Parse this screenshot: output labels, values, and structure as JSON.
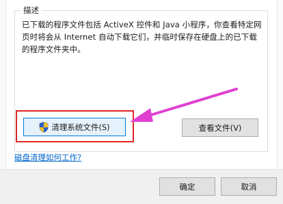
{
  "group": {
    "legend": "描述",
    "description_lines": [
      "已下载的程序文件包括 ActiveX 控件和 Java 小程序，你查看特定网",
      "页时将会从 Internet 自动下载它们，并临时保存在硬盘上的已下载",
      "的程序文件夹中。"
    ]
  },
  "buttons": {
    "clean_system_files": "清理系统文件(S)",
    "view_files": "查看文件(V)",
    "ok": "确定",
    "cancel": "取消"
  },
  "link": {
    "how_disk_cleanup_works": "磁盘清理如何工作?"
  },
  "annotation": {
    "highlight_color": "#e02424",
    "arrow_color": "#e040d0"
  },
  "icons": {
    "uac_shield": "uac-shield-icon"
  }
}
